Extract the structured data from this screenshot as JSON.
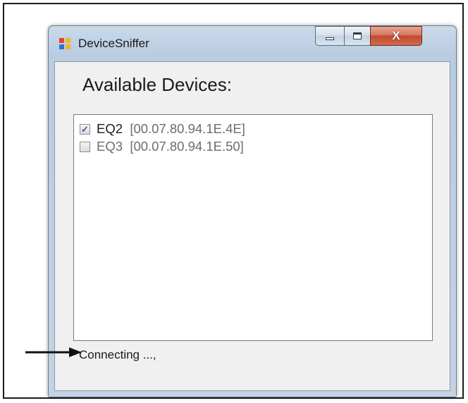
{
  "window": {
    "title": "DeviceSniffer",
    "controls": {
      "minimize": "minimize",
      "maximize": "maximize",
      "close": "close"
    }
  },
  "main": {
    "heading": "Available Devices:",
    "devices": [
      {
        "name": "EQ2",
        "address": "[00.07.80.94.1E.4E]",
        "checked": true
      },
      {
        "name": "EQ3",
        "address": "[00.07.80.94.1E.50]",
        "checked": false
      }
    ],
    "status": "Connecting ...,"
  },
  "icons": {
    "app": "app-window-icon",
    "checkmark": "checkmark-icon",
    "arrow": "arrow-right-icon"
  },
  "colors": {
    "title_bar": "#c3d3e4",
    "close_button": "#c2492f",
    "client_background": "#f0f0f0",
    "item_text": "#6d6d6d"
  }
}
